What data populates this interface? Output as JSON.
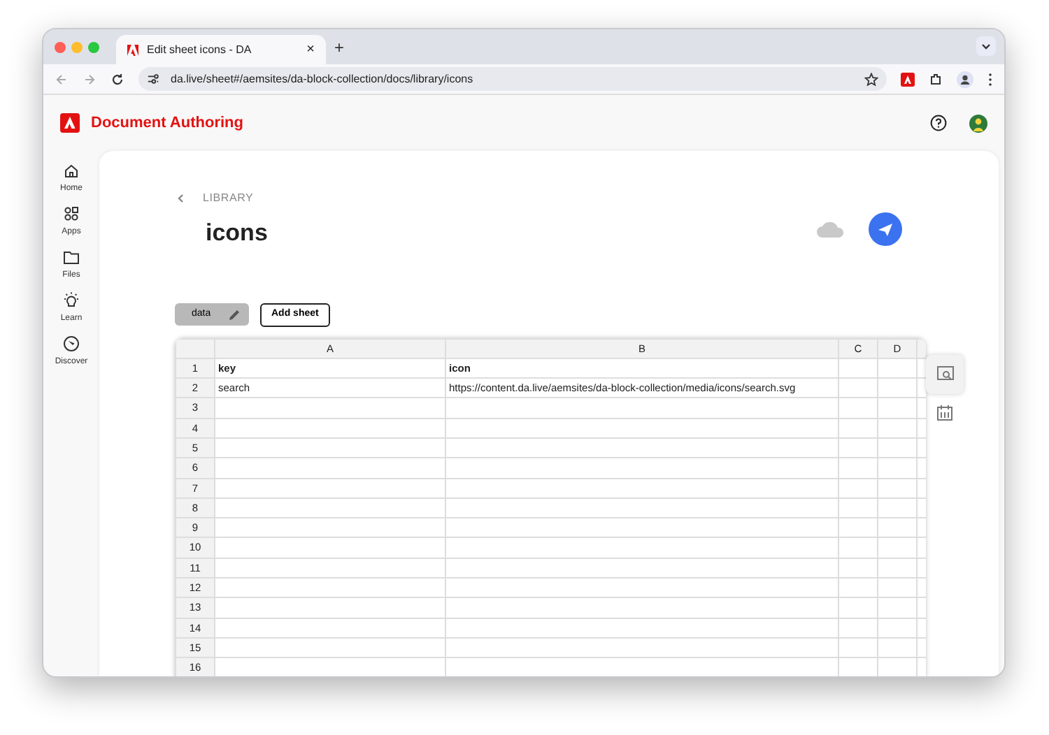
{
  "browser": {
    "tab_title": "Edit sheet icons - DA",
    "close_tab": "×",
    "new_tab": "+",
    "url": "da.live/sheet#/aemsites/da-block-collection/docs/library/icons"
  },
  "app": {
    "title": "Document Authoring"
  },
  "sidebar": {
    "items": [
      {
        "label": "Home"
      },
      {
        "label": "Apps"
      },
      {
        "label": "Files"
      },
      {
        "label": "Learn"
      },
      {
        "label": "Discover"
      }
    ]
  },
  "breadcrumb": "LIBRARY",
  "heading": "icons",
  "sheet_tabs": [
    {
      "label": "data",
      "selected": true
    }
  ],
  "add_sheet": "Add sheet",
  "table": {
    "columns": [
      "A",
      "B",
      "C",
      "D"
    ],
    "rows": [
      {
        "number": "1",
        "bold": true,
        "cells": [
          "key",
          "icon",
          "",
          ""
        ]
      },
      {
        "number": "2",
        "bold": false,
        "cells": [
          "search",
          "https://content.da.live/aemsites/da-block-collection/media/icons/search.svg",
          "",
          ""
        ]
      },
      {
        "number": "3",
        "cells": [
          "",
          "",
          "",
          ""
        ]
      },
      {
        "number": "4",
        "cells": [
          "",
          "",
          "",
          ""
        ]
      },
      {
        "number": "5",
        "cells": [
          "",
          "",
          "",
          ""
        ]
      },
      {
        "number": "6",
        "cells": [
          "",
          "",
          "",
          ""
        ]
      },
      {
        "number": "7",
        "cells": [
          "",
          "",
          "",
          ""
        ]
      },
      {
        "number": "8",
        "cells": [
          "",
          "",
          "",
          ""
        ]
      },
      {
        "number": "9",
        "cells": [
          "",
          "",
          "",
          ""
        ]
      },
      {
        "number": "10",
        "cells": [
          "",
          "",
          "",
          ""
        ]
      },
      {
        "number": "11",
        "cells": [
          "",
          "",
          "",
          ""
        ]
      },
      {
        "number": "12",
        "cells": [
          "",
          "",
          "",
          ""
        ]
      },
      {
        "number": "13",
        "cells": [
          "",
          "",
          "",
          ""
        ]
      },
      {
        "number": "14",
        "cells": [
          "",
          "",
          "",
          ""
        ]
      },
      {
        "number": "15",
        "cells": [
          "",
          "",
          "",
          ""
        ]
      },
      {
        "number": "16",
        "cells": [
          "",
          "",
          "",
          ""
        ]
      }
    ]
  }
}
